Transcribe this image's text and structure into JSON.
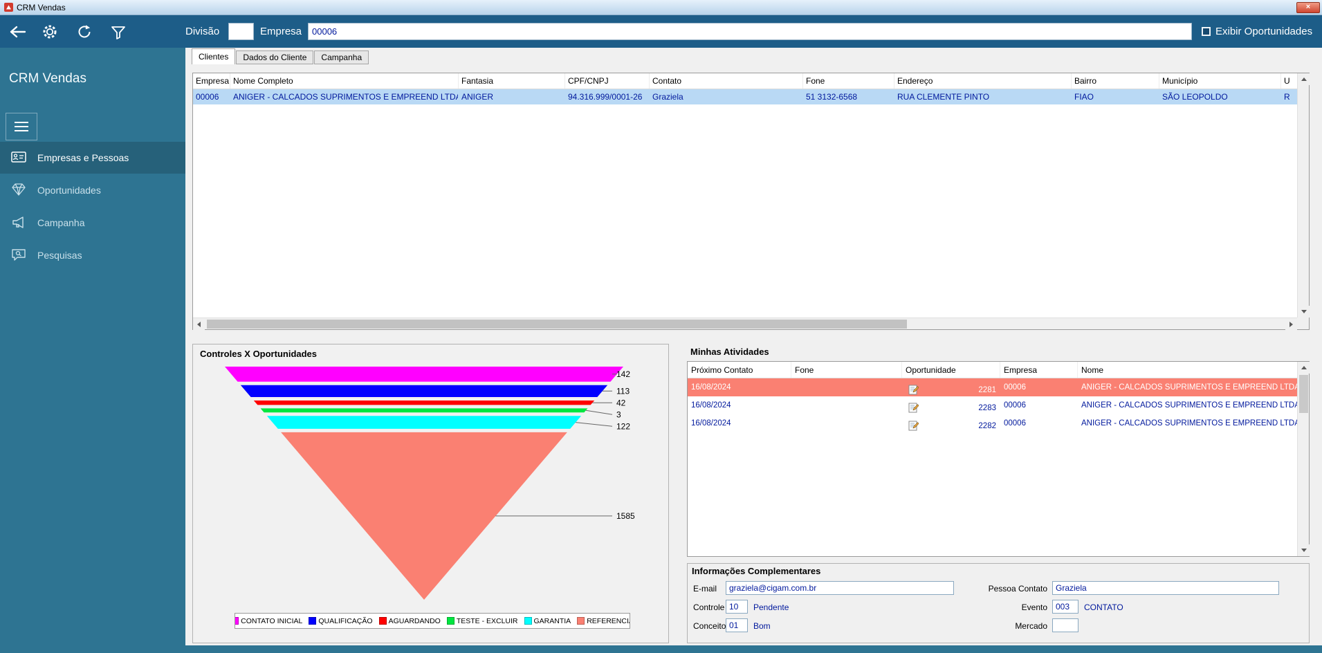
{
  "window": {
    "title": "CRM Vendas",
    "close_glyph": "×"
  },
  "toolbar": {
    "divisao_label": "Divisão",
    "divisao_value": "",
    "empresa_label": "Empresa",
    "empresa_value": "00006",
    "exibir_oportunidades_label": "Exibir Oportunidades"
  },
  "sidebar": {
    "title": "CRM Vendas",
    "items": [
      {
        "label": "Empresas e Pessoas",
        "icon": "people-card-icon",
        "selected": true
      },
      {
        "label": "Oportunidades",
        "icon": "diamond-icon",
        "selected": false
      },
      {
        "label": "Campanha",
        "icon": "megaphone-icon",
        "selected": false
      },
      {
        "label": "Pesquisas",
        "icon": "chat-search-icon",
        "selected": false
      }
    ]
  },
  "tabs": [
    {
      "label": "Clientes",
      "active": true
    },
    {
      "label": "Dados do Cliente",
      "active": false
    },
    {
      "label": "Campanha",
      "active": false
    }
  ],
  "clients_grid": {
    "columns": [
      "Empresa",
      "Nome Completo",
      "Fantasia",
      "CPF/CNPJ",
      "Contato",
      "Fone",
      "Endereço",
      "Bairro",
      "Município",
      "U"
    ],
    "rows": [
      {
        "selected": true,
        "cells": [
          "00006",
          "ANIGER - CALCADOS SUPRIMENTOS E EMPREEND LTDA",
          "ANIGER",
          "94.316.999/0001-26",
          "Graziela",
          "51 3132-6568",
          "RUA CLEMENTE PINTO",
          "FIAO",
          "SÃO LEOPOLDO",
          "R"
        ]
      }
    ]
  },
  "chart_data": {
    "type": "funnel",
    "title": "Controles X Oportunidades",
    "legend_position": "bottom",
    "segments": [
      {
        "label": "CONTATO INICIAL",
        "value": 142,
        "color": "#ff00ff"
      },
      {
        "label": "QUALIFICAÇÃO",
        "value": 113,
        "color": "#0000ff"
      },
      {
        "label": "AGUARDANDO",
        "value": 42,
        "color": "#ff0000"
      },
      {
        "label": "TESTE - EXCLUIR",
        "value": 3,
        "color": "#00e640"
      },
      {
        "label": "GARANTIA",
        "value": 122,
        "color": "#00ffff"
      },
      {
        "label": "REFERENCIA",
        "value": 1585,
        "color": "#fa8072"
      }
    ]
  },
  "activities": {
    "title": "Minhas Atividades",
    "columns": [
      "Próximo Contato",
      "Fone",
      "Oportunidade",
      "Empresa",
      "Nome"
    ],
    "rows": [
      {
        "highlighted": true,
        "proximo_contato": "16/08/2024",
        "fone": "",
        "oportunidade": "2281",
        "empresa": "00006",
        "nome": "ANIGER - CALCADOS SUPRIMENTOS E EMPREEND LTDA"
      },
      {
        "highlighted": false,
        "proximo_contato": "16/08/2024",
        "fone": "",
        "oportunidade": "2283",
        "empresa": "00006",
        "nome": "ANIGER - CALCADOS SUPRIMENTOS E EMPREEND LTDA"
      },
      {
        "highlighted": false,
        "proximo_contato": "16/08/2024",
        "fone": "",
        "oportunidade": "2282",
        "empresa": "00006",
        "nome": "ANIGER - CALCADOS SUPRIMENTOS E EMPREEND LTDA"
      }
    ]
  },
  "info": {
    "title": "Informações Complementares",
    "fields": {
      "email": {
        "label": "E-mail",
        "value": "graziela@cigam.com.br"
      },
      "pessoa_contato": {
        "label": "Pessoa Contato",
        "value": "Graziela"
      },
      "controle": {
        "label": "Controle",
        "value": "10",
        "desc": "Pendente"
      },
      "evento": {
        "label": "Evento",
        "value": "003",
        "desc": "CONTATO"
      },
      "conceito": {
        "label": "Conceito",
        "value": "01",
        "desc": "Bom"
      },
      "mercado": {
        "label": "Mercado",
        "value": ""
      }
    }
  },
  "colors": {
    "titlebar_bg": "#bcd6ee",
    "toolbar_bg": "#1d5d88",
    "sidebar_bg": "#2e7492",
    "selected_row_bg": "#b9d9f5",
    "highlight_row_bg": "#fa8072",
    "value_text": "#00189c"
  }
}
